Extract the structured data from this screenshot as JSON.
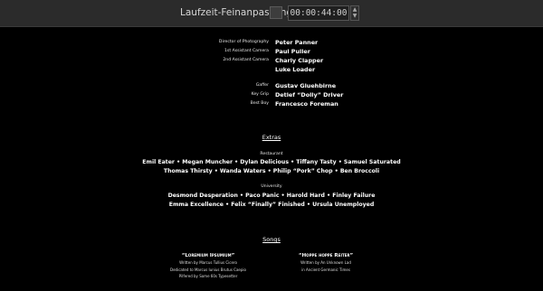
{
  "toolbar": {
    "title": "Laufzeit-Feinanpassung",
    "time": "00:00:44:00",
    "spin_up": "▲",
    "spin_down": "▼"
  },
  "crew": [
    {
      "role": "Director of Photography",
      "names": [
        "Peter Panner"
      ]
    },
    {
      "role": "1st Assistant Camera",
      "names": [
        "Paul Puller"
      ]
    },
    {
      "role": "2nd Assistant Camera",
      "names": [
        "Charly Clapper",
        "Luke Loader"
      ]
    },
    {
      "role": "Gaffer",
      "names": [
        "Gustav Gluehbirne"
      ]
    },
    {
      "role": "Key Grip",
      "names": [
        "Detlef “Dolly” Driver"
      ]
    },
    {
      "role": "Best Boy",
      "names": [
        "Francesco Foreman"
      ]
    }
  ],
  "extras": {
    "heading": "Extras",
    "groups": [
      {
        "label": "Restaurant",
        "lines": [
          "Emil Eater • Megan Muncher • Dylan Delicious • Tiffany Tasty • Samuel Saturated",
          "Thomas Thirsty • Wanda Waters • Philip “Pork” Chop • Ben Broccoli"
        ]
      },
      {
        "label": "University",
        "lines": [
          "Desmond Desperation • Paco Panic • Harold Hard • Finley Failure",
          "Emma Excellence • Felix “Finally” Finished • Ursula Unemployed"
        ]
      }
    ]
  },
  "songs": {
    "heading": "Songs",
    "items": [
      {
        "title": "“Loremium Ipsumium”",
        "credits": [
          "Written by Marcus Tullius Cicero",
          "Dedicated to Marcus Iunius Brutus Caepio",
          "Pilfered by Some 60s Typesetter"
        ]
      },
      {
        "title": "“Hoppe hoppe Reiter”",
        "credits": [
          "Written by An Unknown Lad",
          "in Ancient Germanic Times"
        ]
      }
    ]
  }
}
